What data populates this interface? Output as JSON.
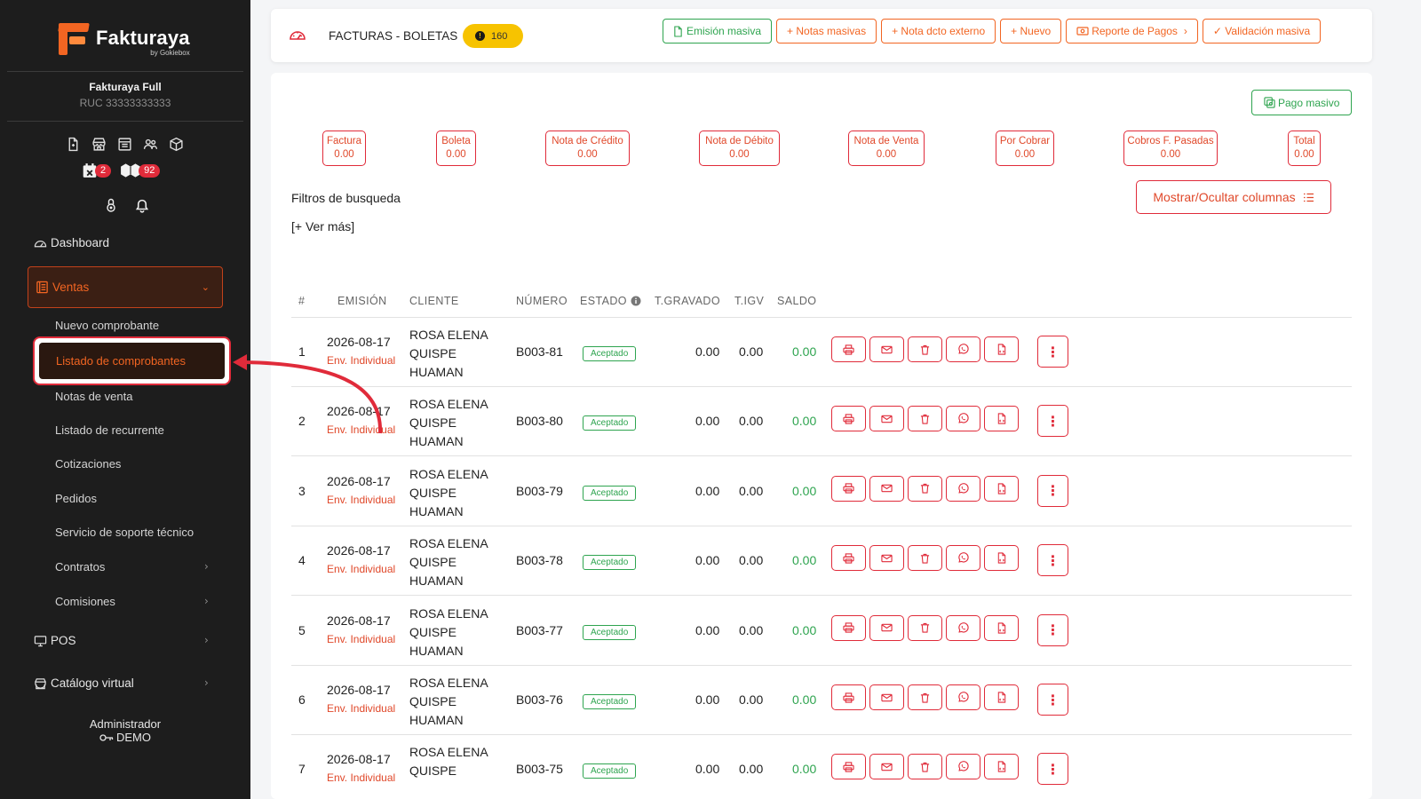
{
  "colors": {
    "accent": "#f26522",
    "danger": "#e02b3a",
    "success": "#2ea44f",
    "sidebar_bg": "#1d1d1d",
    "badge_yellow": "#f7c300"
  },
  "brand": {
    "name": "Fakturaya",
    "sub": "by Gokiebox"
  },
  "company": {
    "name": "Fakturaya Full",
    "ruc": "RUC 33333333333"
  },
  "sidebar": {
    "badges": {
      "calendar": "2",
      "boxes": "92"
    },
    "dashboard": "Dashboard",
    "ventas": "Ventas",
    "sub_items": [
      {
        "label": "Nuevo comprobante"
      },
      {
        "label": "Listado de comprobantes"
      },
      {
        "label": "Notas de venta"
      },
      {
        "label": "Listado de recurrente"
      },
      {
        "label": "Cotizaciones"
      },
      {
        "label": "Pedidos"
      },
      {
        "label": "Servicio de soporte técnico"
      },
      {
        "label": "Contratos"
      },
      {
        "label": "Comisiones"
      }
    ],
    "pos": "POS",
    "catalogo": "Catálogo virtual",
    "admin": {
      "role": "Administrador",
      "user": "DEMO"
    }
  },
  "header": {
    "title": "FACTURAS - BOLETAS",
    "badge": "160",
    "buttons": {
      "emision": "Emisión masiva",
      "notas": "+ Notas masivas",
      "nota_externo": "+ Nota dcto externo",
      "nuevo": "+ Nuevo",
      "reporte": "Reporte de Pagos",
      "validacion": "✓ Validación masiva"
    }
  },
  "main": {
    "pago_masivo": "Pago masivo",
    "totals": [
      {
        "label": "Factura",
        "value": "0.00"
      },
      {
        "label": "Boleta",
        "value": "0.00"
      },
      {
        "label": "Nota de Crédito",
        "value": "0.00"
      },
      {
        "label": "Nota de Débito",
        "value": "0.00"
      },
      {
        "label": "Nota de Venta",
        "value": "0.00"
      },
      {
        "label": "Por Cobrar",
        "value": "0.00"
      },
      {
        "label": "Cobros F. Pasadas",
        "value": "0.00"
      },
      {
        "label": "Total",
        "value": "0.00"
      }
    ],
    "filtros": "Filtros de busqueda",
    "ver_mas": "[+ Ver más]",
    "columns_btn": "Mostrar/Ocultar columnas"
  },
  "table": {
    "headers": {
      "num": "#",
      "emision": "EMISIÓN",
      "cliente": "CLIENTE",
      "numero": "NÚMERO",
      "estado": "ESTADO",
      "gravado": "T.GRAVADO",
      "igv": "T.IGV",
      "saldo": "SALDO"
    },
    "rows": [
      {
        "n": "1",
        "fecha": "2026-08-17",
        "tipo": "Env. Individual",
        "c1": "ROSA ELENA",
        "c2": "QUISPE",
        "c3": "HUAMAN",
        "numero": "B003-81",
        "estado": "Aceptado",
        "gravado": "0.00",
        "igv": "0.00",
        "saldo": "0.00"
      },
      {
        "n": "2",
        "fecha": "2026-08-17",
        "tipo": "Env. Individual",
        "c1": "ROSA ELENA",
        "c2": "QUISPE",
        "c3": "HUAMAN",
        "numero": "B003-80",
        "estado": "Aceptado",
        "gravado": "0.00",
        "igv": "0.00",
        "saldo": "0.00"
      },
      {
        "n": "3",
        "fecha": "2026-08-17",
        "tipo": "Env. Individual",
        "c1": "ROSA ELENA",
        "c2": "QUISPE",
        "c3": "HUAMAN",
        "numero": "B003-79",
        "estado": "Aceptado",
        "gravado": "0.00",
        "igv": "0.00",
        "saldo": "0.00"
      },
      {
        "n": "4",
        "fecha": "2026-08-17",
        "tipo": "Env. Individual",
        "c1": "ROSA ELENA",
        "c2": "QUISPE",
        "c3": "HUAMAN",
        "numero": "B003-78",
        "estado": "Aceptado",
        "gravado": "0.00",
        "igv": "0.00",
        "saldo": "0.00"
      },
      {
        "n": "5",
        "fecha": "2026-08-17",
        "tipo": "Env. Individual",
        "c1": "ROSA ELENA",
        "c2": "QUISPE",
        "c3": "HUAMAN",
        "numero": "B003-77",
        "estado": "Aceptado",
        "gravado": "0.00",
        "igv": "0.00",
        "saldo": "0.00"
      },
      {
        "n": "6",
        "fecha": "2026-08-17",
        "tipo": "Env. Individual",
        "c1": "ROSA ELENA",
        "c2": "QUISPE",
        "c3": "HUAMAN",
        "numero": "B003-76",
        "estado": "Aceptado",
        "gravado": "0.00",
        "igv": "0.00",
        "saldo": "0.00"
      },
      {
        "n": "7",
        "fecha": "2026-08-17",
        "tipo": "Env. Individual",
        "c1": "ROSA ELENA",
        "c2": "QUISPE",
        "c3": "",
        "numero": "B003-75",
        "estado": "Aceptado",
        "gravado": "0.00",
        "igv": "0.00",
        "saldo": "0.00"
      }
    ]
  }
}
